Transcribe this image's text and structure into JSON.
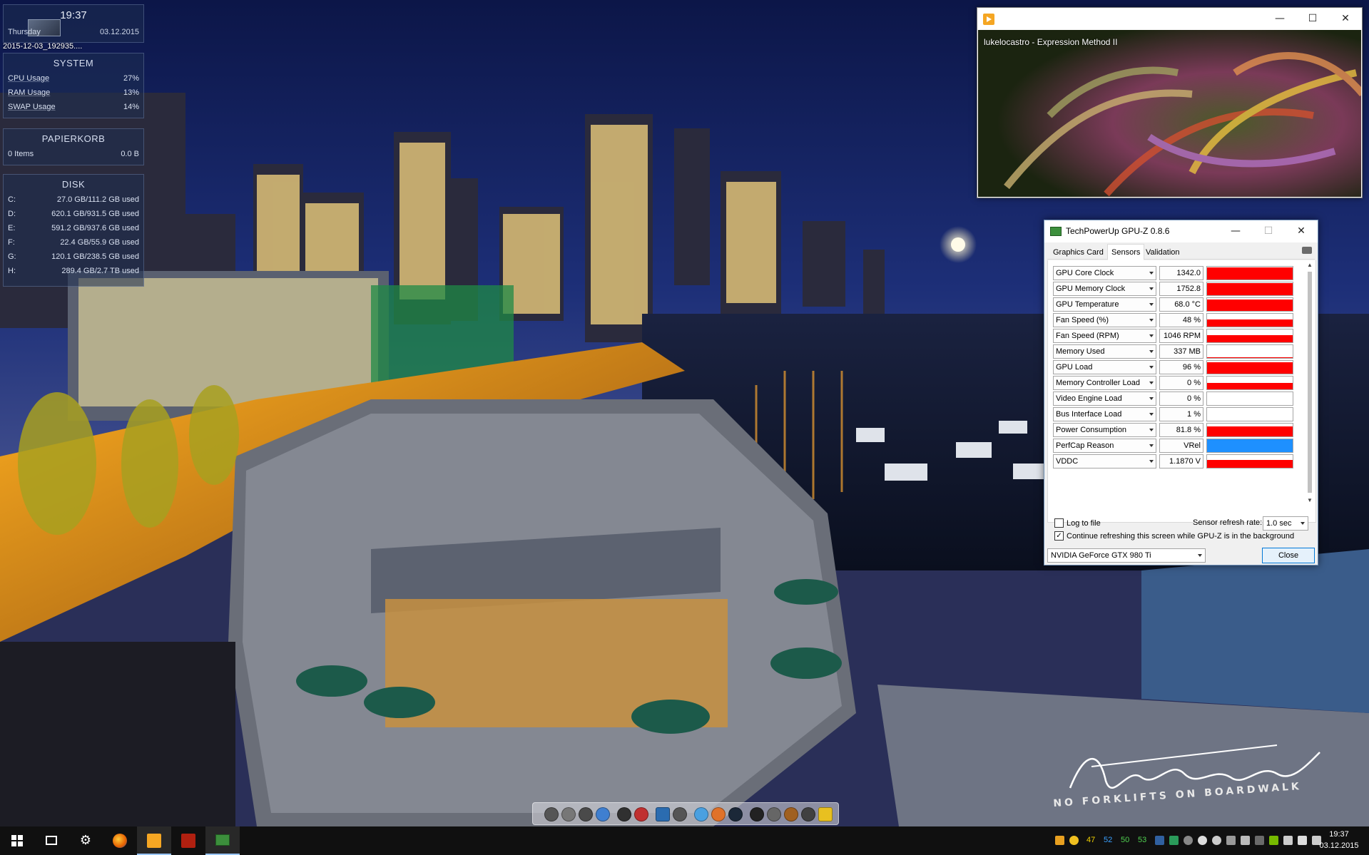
{
  "desktop": {
    "clock_widget": {
      "time": "19:37",
      "day": "Thursday",
      "date": "03.12.2015"
    },
    "screenshot_label": "2015-12-03_192935....",
    "system_widget": {
      "title": "SYSTEM",
      "rows": [
        {
          "label": "CPU Usage",
          "value": "27%"
        },
        {
          "label": "RAM Usage",
          "value": "13%"
        },
        {
          "label": "SWAP Usage",
          "value": "14%"
        }
      ]
    },
    "papierkorb_widget": {
      "title": "PAPIERKORB",
      "items": "0 Items",
      "size": "0.0 B"
    },
    "disk_widget": {
      "title": "DISK",
      "rows": [
        {
          "label": "C:",
          "value": "27.0 GB/111.2 GB used"
        },
        {
          "label": "D:",
          "value": "620.1 GB/931.5 GB used"
        },
        {
          "label": "E:",
          "value": "591.2 GB/937.6 GB used"
        },
        {
          "label": "F:",
          "value": "22.4 GB/55.9 GB used"
        },
        {
          "label": "G:",
          "value": "120.1 GB/238.5 GB used"
        },
        {
          "label": "H:",
          "value": "289.4 GB/2.7 TB used"
        }
      ]
    },
    "signature": {
      "name": "Talha Bin Tariq",
      "sign_text": "NO FORKLIFTS ON BOARDWALK"
    }
  },
  "media_window": {
    "controls": {
      "minimize": "—",
      "maximize": "☐",
      "close": "✕"
    },
    "track": "lukelocastro - Expression Method II"
  },
  "gpuz": {
    "title": "TechPowerUp GPU-Z 0.8.6",
    "controls": {
      "minimize": "—",
      "maximize": "☐",
      "close": "✕"
    },
    "tabs": [
      "Graphics Card",
      "Sensors",
      "Validation"
    ],
    "active_tab": "Sensors",
    "sensors": [
      {
        "name": "GPU Core Clock",
        "value": "1342.0 MHz",
        "level": 0.92,
        "color": "#ff0000"
      },
      {
        "name": "GPU Memory Clock",
        "value": "1752.8 MHz",
        "level": 0.92,
        "color": "#ff0000"
      },
      {
        "name": "GPU Temperature",
        "value": "68.0 °C",
        "level": 0.9,
        "color": "#ff0000"
      },
      {
        "name": "Fan Speed (%)",
        "value": "48 %",
        "level": 0.55,
        "color": "#ff0000"
      },
      {
        "name": "Fan Speed (RPM)",
        "value": "1046 RPM",
        "level": 0.55,
        "color": "#ff0000"
      },
      {
        "name": "Memory Used",
        "value": "337 MB",
        "level": 0.08,
        "color": "#ff0000"
      },
      {
        "name": "GPU Load",
        "value": "96 %",
        "level": 0.9,
        "color": "#ff0000"
      },
      {
        "name": "Memory Controller Load",
        "value": "0 %",
        "level": 0.5,
        "color": "#ff0000"
      },
      {
        "name": "Video Engine Load",
        "value": "0 %",
        "level": 0.0,
        "color": "#ff0000"
      },
      {
        "name": "Bus Interface Load",
        "value": "1 %",
        "level": 0.0,
        "color": "#ff0000"
      },
      {
        "name": "Power Consumption",
        "value": "81.8 % TDP",
        "level": 0.8,
        "color": "#ff0000"
      },
      {
        "name": "PerfCap Reason",
        "value": "VRel",
        "level": 1.0,
        "color": "#1e90ff"
      },
      {
        "name": "VDDC",
        "value": "1.1870 V",
        "level": 0.6,
        "color": "#ff0000"
      }
    ],
    "log_to_file": {
      "label": "Log to file",
      "checked": false
    },
    "refresh_rate": {
      "label": "Sensor refresh rate:",
      "value": "1.0 sec"
    },
    "continue_refreshing": {
      "label": "Continue refreshing this screen while GPU-Z is in the background",
      "checked": true
    },
    "gpu_select": "NVIDIA GeForce GTX 980 Ti",
    "close_label": "Close"
  },
  "taskbar": {
    "apps": [
      "start-button",
      "task-view-button",
      "settings-app",
      "firefox-app",
      "media-player-app",
      "app-5",
      "gpuz-app"
    ],
    "tray_numbers": [
      {
        "value": "47",
        "color": "#f0d000"
      },
      {
        "value": "52",
        "color": "#3aa0ff"
      },
      {
        "value": "50",
        "color": "#50d050"
      },
      {
        "value": "53",
        "color": "#50d050"
      }
    ],
    "time": "19:37",
    "date": "03.12.2015"
  }
}
